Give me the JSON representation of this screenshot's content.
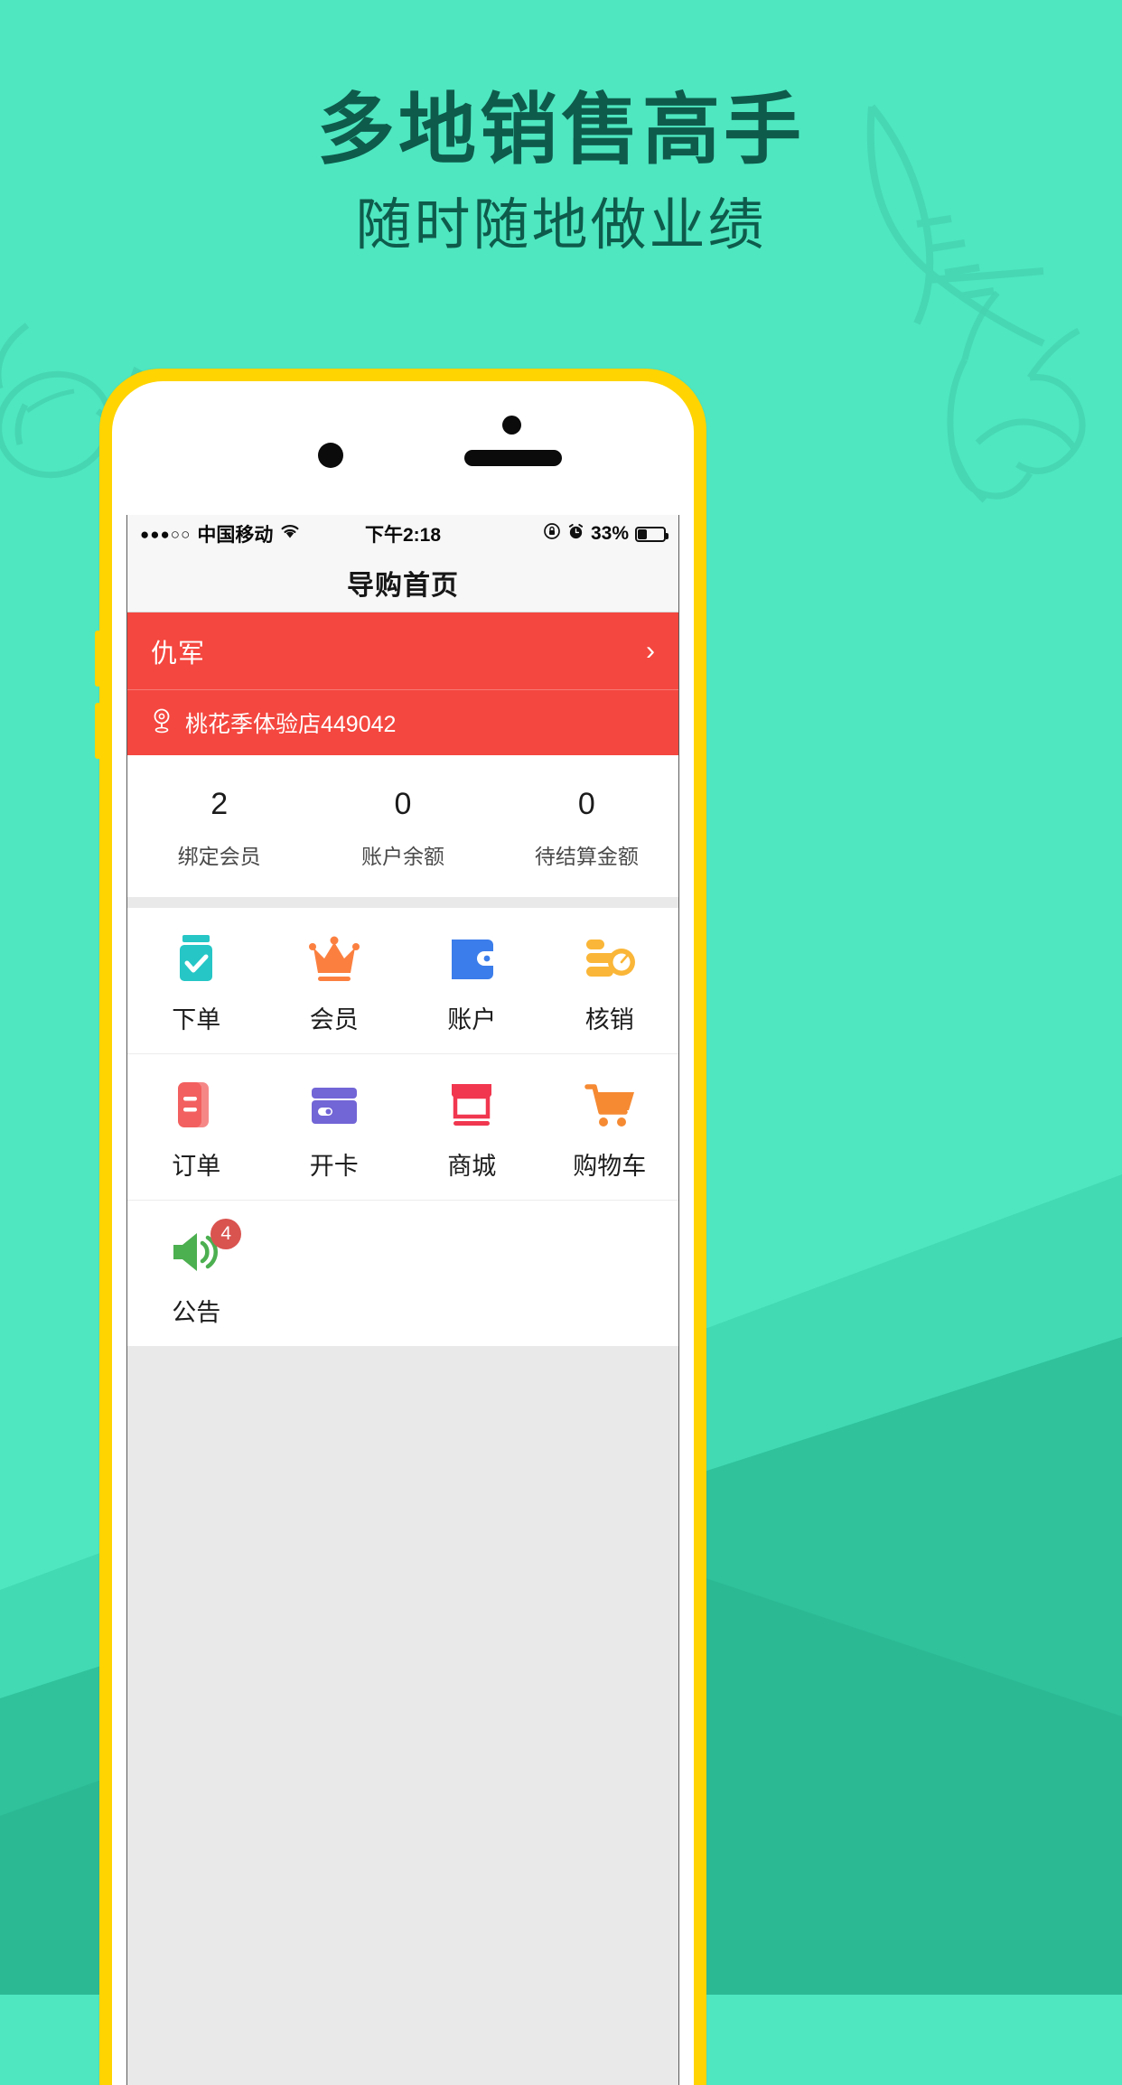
{
  "promo": {
    "headline": "多地销售高手",
    "subhead": "随时随地做业绩",
    "headline_color": "#0E5B4B",
    "bg_color": "#4EE7C0"
  },
  "decor": {
    "sunglasses": "sunglasses-doodle",
    "flipflop": "flipflop-doodle",
    "bikini": "bikini-top-doodle",
    "hills": "hill-shapes"
  },
  "phone": {
    "body_color": "#FFD400",
    "camera": "camera-dot",
    "sensor": "sensor-dot",
    "speaker": "speaker-grille"
  },
  "statusbar": {
    "signal_dots": "●●●○○",
    "carrier": "中国移动",
    "wifi": "wifi-icon",
    "time": "下午2:18",
    "rotation_lock": "rotation-lock-icon",
    "alarm": "alarm-clock-icon",
    "battery_pct": "33%",
    "battery_level": 33
  },
  "navbar": {
    "title": "导购首页"
  },
  "header": {
    "user_name": "仇军",
    "chevron": "›",
    "store_icon": "location-pin-icon",
    "store_name": "桃花季体验店449042",
    "bg_color": "#F4473F"
  },
  "stats": [
    {
      "value": "2",
      "label": "绑定会员"
    },
    {
      "value": "0",
      "label": "账户余额"
    },
    {
      "value": "0",
      "label": "待结算金额"
    }
  ],
  "grid": [
    [
      {
        "label": "下单",
        "icon": "clipboard-check-icon",
        "color": "#26C6C6"
      },
      {
        "label": "会员",
        "icon": "crown-icon",
        "color": "#FB8040"
      },
      {
        "label": "账户",
        "icon": "wallet-icon",
        "color": "#3B7DEA"
      },
      {
        "label": "核销",
        "icon": "coins-clock-icon",
        "color": "#FAB638"
      }
    ],
    [
      {
        "label": "订单",
        "icon": "order-book-icon",
        "color": "#F2605F"
      },
      {
        "label": "开卡",
        "icon": "credit-card-icon",
        "color": "#7265D6"
      },
      {
        "label": "商城",
        "icon": "shop-icon",
        "color": "#F1374F"
      },
      {
        "label": "购物车",
        "icon": "shopping-cart-icon",
        "color": "#F58A33"
      }
    ],
    [
      {
        "label": "公告",
        "icon": "speaker-announcement-icon",
        "color": "#4CAF50",
        "badge": "4"
      }
    ]
  ]
}
